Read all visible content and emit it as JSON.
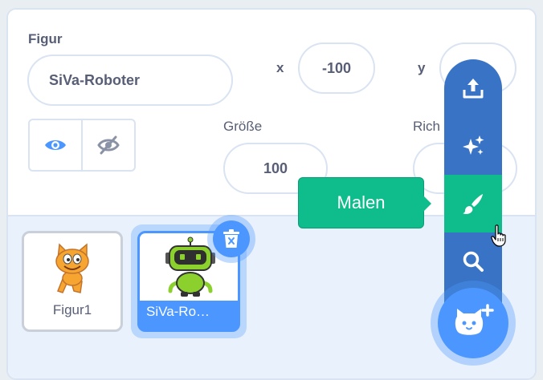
{
  "sprite_info": {
    "sprite_label": "Figur",
    "sprite_name": "SiVa-Roboter",
    "x_label": "x",
    "x_value": "-100",
    "y_label": "y",
    "size_label": "Größe",
    "size_value": "100",
    "direction_label": "Rich"
  },
  "visibility": {
    "show_icon": "eye-icon",
    "hide_icon": "eye-slash-icon",
    "selected": "show"
  },
  "sprites": [
    {
      "name": "Figur1",
      "icon": "cat-sprite",
      "selected": false
    },
    {
      "name": "SiVa-Ro…",
      "icon": "robot-sprite",
      "selected": true
    }
  ],
  "delete_icon": "trash-icon",
  "add_sprite_menu": {
    "items": [
      {
        "icon": "upload-icon"
      },
      {
        "icon": "surprise-sparkle-icon"
      },
      {
        "icon": "paint-brush-icon",
        "active": true
      },
      {
        "icon": "search-icon"
      }
    ],
    "fab_icon": "cat-plus-icon",
    "tooltip": "Malen"
  },
  "colors": {
    "primary": "#4c97ff",
    "menu": "#3873c5",
    "active": "#0fbd8c",
    "text": "#575e75"
  }
}
